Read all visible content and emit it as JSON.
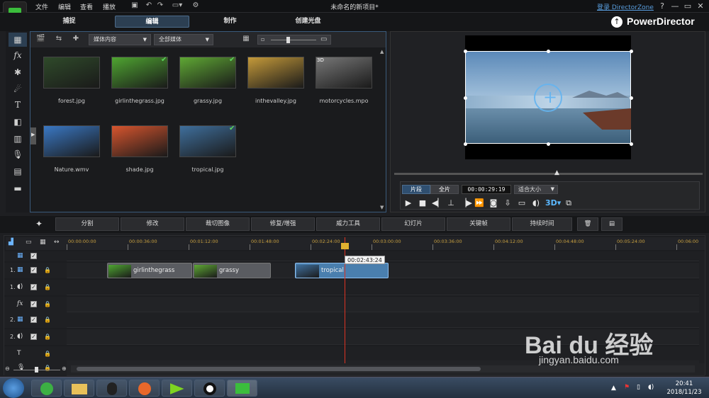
{
  "menu": {
    "items": [
      "文件",
      "编辑",
      "查看",
      "播放"
    ],
    "title": "未命名的新项目*",
    "login": "登录 DirectorZone",
    "win_buttons": [
      "?",
      "—",
      "▭",
      "✕"
    ]
  },
  "tabs": [
    "捕捉",
    "编辑",
    "制作",
    "创建光盘"
  ],
  "brand": "PowerDirector",
  "media_toolbar": {
    "dropdown1": "媒体内容",
    "dropdown2": "全部媒体"
  },
  "media_items": [
    {
      "label": "forest.jpg",
      "checked": false,
      "color": "#2f4a2a"
    },
    {
      "label": "girlinthegrass.jpg",
      "checked": true,
      "color": "#4fa531"
    },
    {
      "label": "grassy.jpg",
      "checked": true,
      "color": "#5fa834"
    },
    {
      "label": "inthevalley.jpg",
      "checked": false,
      "color": "#c59a3a"
    },
    {
      "label": "motorcycles.mpo",
      "checked": false,
      "color": "#777",
      "badge": "3D"
    },
    {
      "label": "Nature.wmv",
      "checked": false,
      "color": "#3a78c4"
    },
    {
      "label": "shade.jpg",
      "checked": false,
      "color": "#d7552e"
    },
    {
      "label": "tropical.jpg",
      "checked": true,
      "color": "#3f6f9c"
    }
  ],
  "preview": {
    "mode_clip": "片段",
    "mode_full": "全片",
    "timecode": "00:00:29:19",
    "fit": "适合大小"
  },
  "edit_toolbar": [
    "分割",
    "修改",
    "裁切图像",
    "修复/增强",
    "威力工具",
    "幻灯片",
    "关键帧",
    "持续时间"
  ],
  "ruler_ticks": [
    "00:00:00:00",
    "00:00:36:00",
    "00:01:12:00",
    "00:01:48:00",
    "00:02:24:00",
    "00:03:00:00",
    "00:03:36:00",
    "00:04:12:00",
    "00:04:48:00",
    "00:05:24:00",
    "00:06:00"
  ],
  "tracks": [
    {
      "num": "",
      "icon": "video",
      "lock": false
    },
    {
      "num": "1.",
      "icon": "video",
      "lock": true
    },
    {
      "num": "1.",
      "icon": "audio",
      "lock": true
    },
    {
      "num": "",
      "icon": "fx",
      "lock": true
    },
    {
      "num": "2.",
      "icon": "video",
      "lock": true
    },
    {
      "num": "2.",
      "icon": "audio",
      "lock": true
    },
    {
      "num": "",
      "icon": "text",
      "lock": true
    },
    {
      "num": "",
      "icon": "voice",
      "lock": true
    }
  ],
  "clips": [
    {
      "label": "girlinthegrass",
      "color": "#4fa531"
    },
    {
      "label": "grassy",
      "color": "#5fa834"
    },
    {
      "label": "tropical",
      "color": "#3f6f9c"
    }
  ],
  "tooltip": "00:02:43:24",
  "taskbar": {
    "time": "20:41",
    "date": "2018/11/23"
  },
  "watermark": {
    "text": "Bai du 经验",
    "url": "jingyan.baidu.com"
  }
}
